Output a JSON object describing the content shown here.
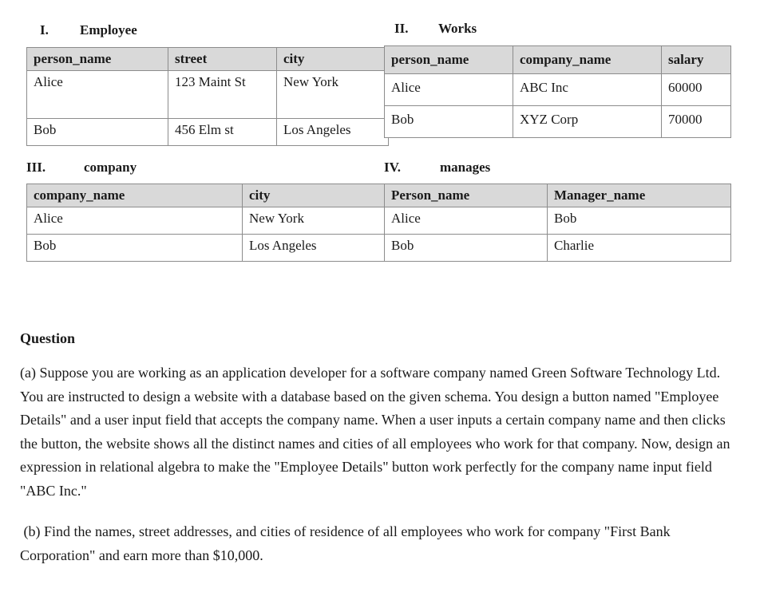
{
  "tables": [
    {
      "numeral": "I.",
      "title": "Employee",
      "columns": [
        "person_name",
        "street",
        "city"
      ],
      "rows": [
        [
          "Alice",
          "123 Maint St",
          "New York"
        ],
        [
          "Bob",
          "456 Elm st",
          "Los Angeles"
        ]
      ]
    },
    {
      "numeral": "II.",
      "title": "Works",
      "columns": [
        "person_name",
        "company_name",
        "salary"
      ],
      "rows": [
        [
          "Alice",
          "ABC Inc",
          "60000"
        ],
        [
          "Bob",
          "XYZ Corp",
          "70000"
        ]
      ]
    },
    {
      "numeral": "III.",
      "title": "company",
      "columns": [
        "company_name",
        "city"
      ],
      "rows": [
        [
          "Alice",
          "New York"
        ],
        [
          "Bob",
          "Los Angeles"
        ]
      ]
    },
    {
      "numeral": "IV.",
      "title": "manages",
      "columns": [
        "Person_name",
        "Manager_name"
      ],
      "rows": [
        [
          "Alice",
          "Bob"
        ],
        [
          "Bob",
          "Charlie"
        ]
      ]
    }
  ],
  "question": {
    "heading": "Question",
    "part_a": "(a) Suppose you are working as an application developer for a software company named Green Software Technology Ltd. You are instructed to design a website with a database based on the given schema. You design a button named \"Employee Details\" and a user input field that accepts the company name. When a user inputs a certain company name and then clicks the button, the website shows all the distinct names and cities of all employees who work for that company. Now, design an expression in relational algebra to make the \"Employee Details\" button work perfectly for the company name input field \"ABC Inc.\"",
    "part_b": " (b) Find the names, street addresses, and cities of residence of all employees who work for company \"First Bank Corporation\" and earn more than $10,000."
  },
  "colors": {
    "header_fill": "#d9d9d9",
    "outer_border": "#3c3c3c",
    "inner_border": "#8c8c8c",
    "text": "#1a1a1a",
    "page_background": "#ffffff"
  }
}
